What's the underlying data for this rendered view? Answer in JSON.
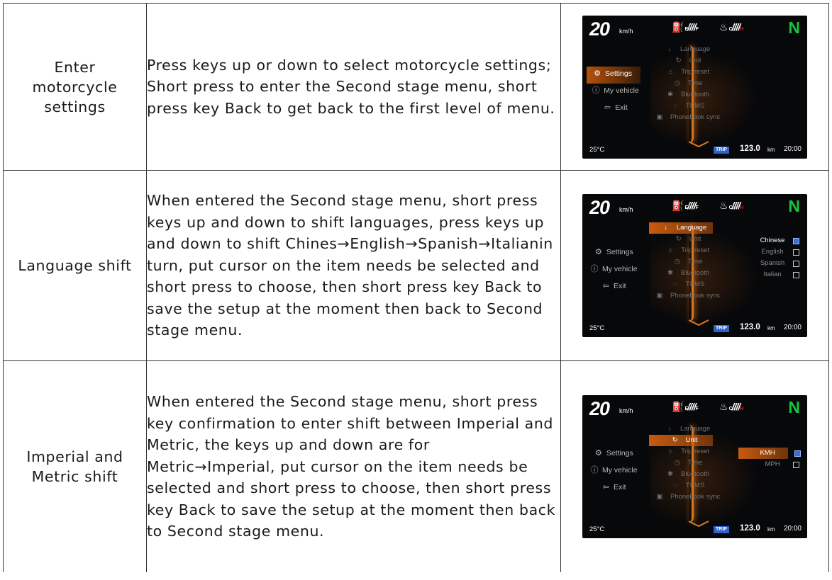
{
  "rows": [
    {
      "action": "Enter motorcycle settings",
      "description": "Press keys up or down to select motorcycle settings; Short press to enter the Second stage menu, short press key Back to get back to the first level of menu.",
      "screen": {
        "speed": "20",
        "speed_unit": "km/h",
        "fuel_empty": "E",
        "fuel_full": "F",
        "temp_cold": "C",
        "temp_hot": "H",
        "gear": "N",
        "main_menu": [
          {
            "icon": "gear-icon",
            "label": "Settings",
            "active": true
          },
          {
            "icon": "info-icon",
            "label": "My vehicle",
            "active": false
          },
          {
            "icon": "exit-icon",
            "label": "Exit",
            "active": false
          }
        ],
        "sub_menu": [
          {
            "icon": "microphone-icon",
            "label": "Language"
          },
          {
            "icon": "refresh-icon",
            "label": "Unit"
          },
          {
            "icon": "trash-icon",
            "label": "Trip reset"
          },
          {
            "icon": "clock-icon",
            "label": "Time"
          },
          {
            "icon": "bluetooth-icon",
            "label": "Bluetooth"
          },
          {
            "icon": "tire-icon",
            "label": "TPMS"
          },
          {
            "icon": "phonebook-icon",
            "label": "Phonebook sync"
          }
        ],
        "active_sub": null,
        "options": [],
        "ambient_temp": "25°C",
        "trip_label": "TRIP",
        "odometer": "123.0",
        "odometer_unit": "km",
        "clock": "20:00"
      }
    },
    {
      "action": "Language shift",
      "description": "When entered the Second stage menu, short press keys up and down to shift languages, press keys up and down to shift Chines→English→Spanish→Italianin turn, put cursor on the item needs be selected and short press to choose, then short press key Back to save the setup at the moment then back to Second stage menu.",
      "screen": {
        "speed": "20",
        "speed_unit": "km/h",
        "fuel_empty": "E",
        "fuel_full": "F",
        "temp_cold": "C",
        "temp_hot": "H",
        "gear": "N",
        "main_menu": [
          {
            "icon": "gear-icon",
            "label": "Settings",
            "active": false
          },
          {
            "icon": "info-icon",
            "label": "My vehicle",
            "active": false
          },
          {
            "icon": "exit-icon",
            "label": "Exit",
            "active": false
          }
        ],
        "sub_menu": [
          {
            "icon": "microphone-icon",
            "label": "Language"
          },
          {
            "icon": "refresh-icon",
            "label": "Unit"
          },
          {
            "icon": "trash-icon",
            "label": "Trip reset"
          },
          {
            "icon": "clock-icon",
            "label": "Time"
          },
          {
            "icon": "bluetooth-icon",
            "label": "Bluetooth"
          },
          {
            "icon": "tire-icon",
            "label": "TPMS"
          },
          {
            "icon": "phonebook-icon",
            "label": "Phonebook sync"
          }
        ],
        "active_sub": 0,
        "options": [
          {
            "label": "Chinese",
            "checked": true,
            "highlight": false
          },
          {
            "label": "English",
            "checked": false,
            "highlight": false
          },
          {
            "label": "Spanish",
            "checked": false,
            "highlight": false
          },
          {
            "label": "Italian",
            "checked": false,
            "highlight": false
          }
        ],
        "ambient_temp": "25°C",
        "trip_label": "TRIP",
        "odometer": "123.0",
        "odometer_unit": "km",
        "clock": "20:00"
      }
    },
    {
      "action": "Imperial and Metric shift",
      "description": "When entered the Second stage menu, short press key confirmation to enter shift between Imperial and Metric, the keys up and down are for Metric→Imperial, put cursor on the item needs be selected and short press to choose, then short press key Back to save the setup at the moment then back to Second stage menu.",
      "screen": {
        "speed": "20",
        "speed_unit": "km/h",
        "fuel_empty": "E",
        "fuel_full": "F",
        "temp_cold": "C",
        "temp_hot": "H",
        "gear": "N",
        "main_menu": [
          {
            "icon": "gear-icon",
            "label": "Settings",
            "active": false
          },
          {
            "icon": "info-icon",
            "label": "My vehicle",
            "active": false
          },
          {
            "icon": "exit-icon",
            "label": "Exit",
            "active": false
          }
        ],
        "sub_menu": [
          {
            "icon": "microphone-icon",
            "label": "Language"
          },
          {
            "icon": "refresh-icon",
            "label": "Unit"
          },
          {
            "icon": "trash-icon",
            "label": "Trip reset"
          },
          {
            "icon": "clock-icon",
            "label": "Time"
          },
          {
            "icon": "bluetooth-icon",
            "label": "Bluetooth"
          },
          {
            "icon": "tire-icon",
            "label": "TPMS"
          },
          {
            "icon": "phonebook-icon",
            "label": "Phonebook sync"
          }
        ],
        "active_sub": 1,
        "options": [
          {
            "label": "KMH",
            "checked": true,
            "highlight": true
          },
          {
            "label": "MPH",
            "checked": false,
            "highlight": false
          }
        ],
        "ambient_temp": "25°C",
        "trip_label": "TRIP",
        "odometer": "123.0",
        "odometer_unit": "km",
        "clock": "20:00"
      }
    }
  ]
}
